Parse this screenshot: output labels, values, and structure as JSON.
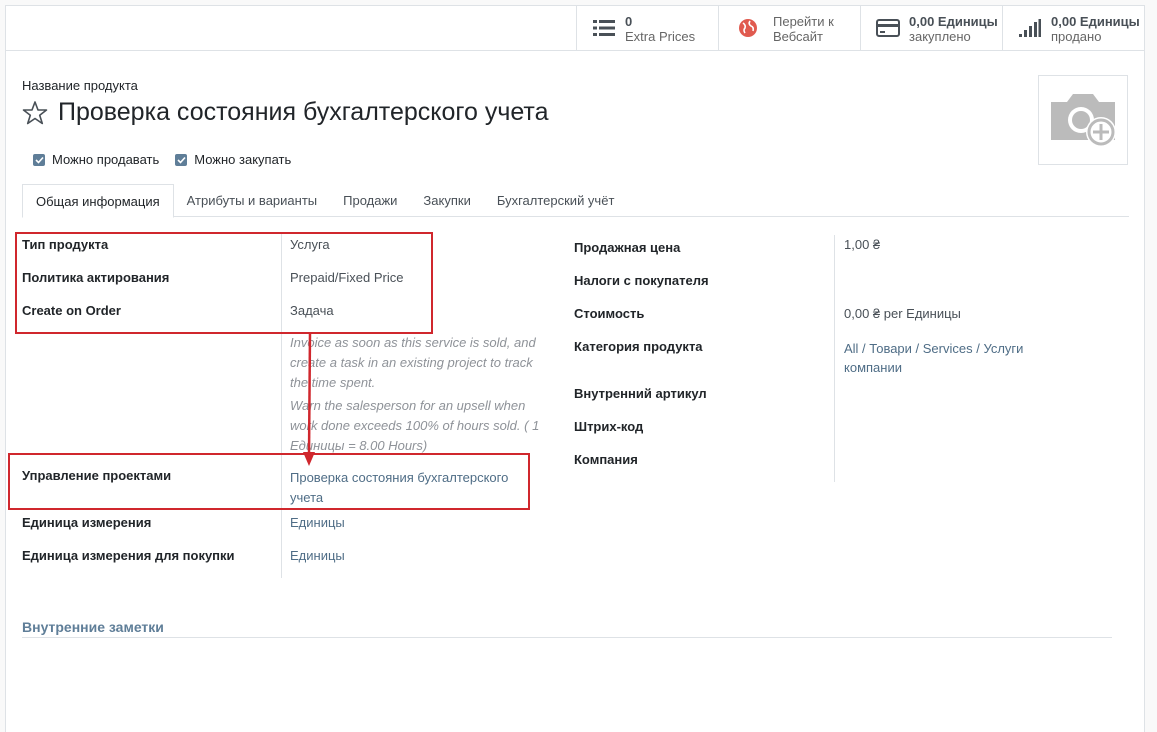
{
  "smart_buttons": [
    {
      "value": "0",
      "label": "Extra Prices",
      "icon": "list-icon"
    },
    {
      "value": "",
      "label": "Перейти к Вебсайт",
      "line1": "Перейти к",
      "line2": "Вебсайт",
      "icon": "globe-icon"
    },
    {
      "value": "0,00 Единицы",
      "label": "закуплено",
      "icon": "credit-card-icon"
    },
    {
      "value": "0,00 Единицы",
      "label": "продано",
      "icon": "signal-icon"
    }
  ],
  "product": {
    "name_label": "Название продукта",
    "name": "Проверка состояния бухгалтерского учета",
    "can_sell_label": "Можно продавать",
    "can_purchase_label": "Можно закупать"
  },
  "tabs": [
    "Общая информация",
    "Атрибуты и варианты",
    "Продажи",
    "Закупки",
    "Бухгалтерский учёт"
  ],
  "left_fields": {
    "type_label": "Тип продукта",
    "type_value": "Услуга",
    "invoice_policy_label": "Политика актирования",
    "invoice_policy_value": "Prepaid/Fixed Price",
    "create_on_order_label": "Create on Order",
    "create_on_order_value": "Задача",
    "help_1": "Invoice as soon as this service is sold, and create a task in an existing project to track the time spent.",
    "help_2": "Warn the salesperson for an upsell when work done exceeds 100% of hours sold. ( 1 Единицы = 8.00 Hours)",
    "project_label": "Управление проектами",
    "project_value": "Проверка состояния бухгалтерского учета",
    "uom_label": "Единица измерения",
    "uom_value": "Единицы",
    "uom_po_label": "Единица измерения для покупки",
    "uom_po_value": "Единицы"
  },
  "right_fields": {
    "sale_price_label": "Продажная цена",
    "sale_price_value": "1,00 ₴",
    "customer_taxes_label": "Налоги с покупателя",
    "cost_label": "Стоимость",
    "cost_value": "0,00 ₴ per Единицы",
    "category_label": "Категория продукта",
    "category_value": "All / Товари / Services / Услуги компании",
    "internal_ref_label": "Внутренний артикул",
    "barcode_label": "Штрих-код",
    "company_label": "Компания"
  },
  "notes": {
    "title": "Внутренние заметки"
  },
  "colors": {
    "annotation_red": "#d0272d",
    "link": "#4f6d86",
    "checkbox": "#5f7e98"
  }
}
